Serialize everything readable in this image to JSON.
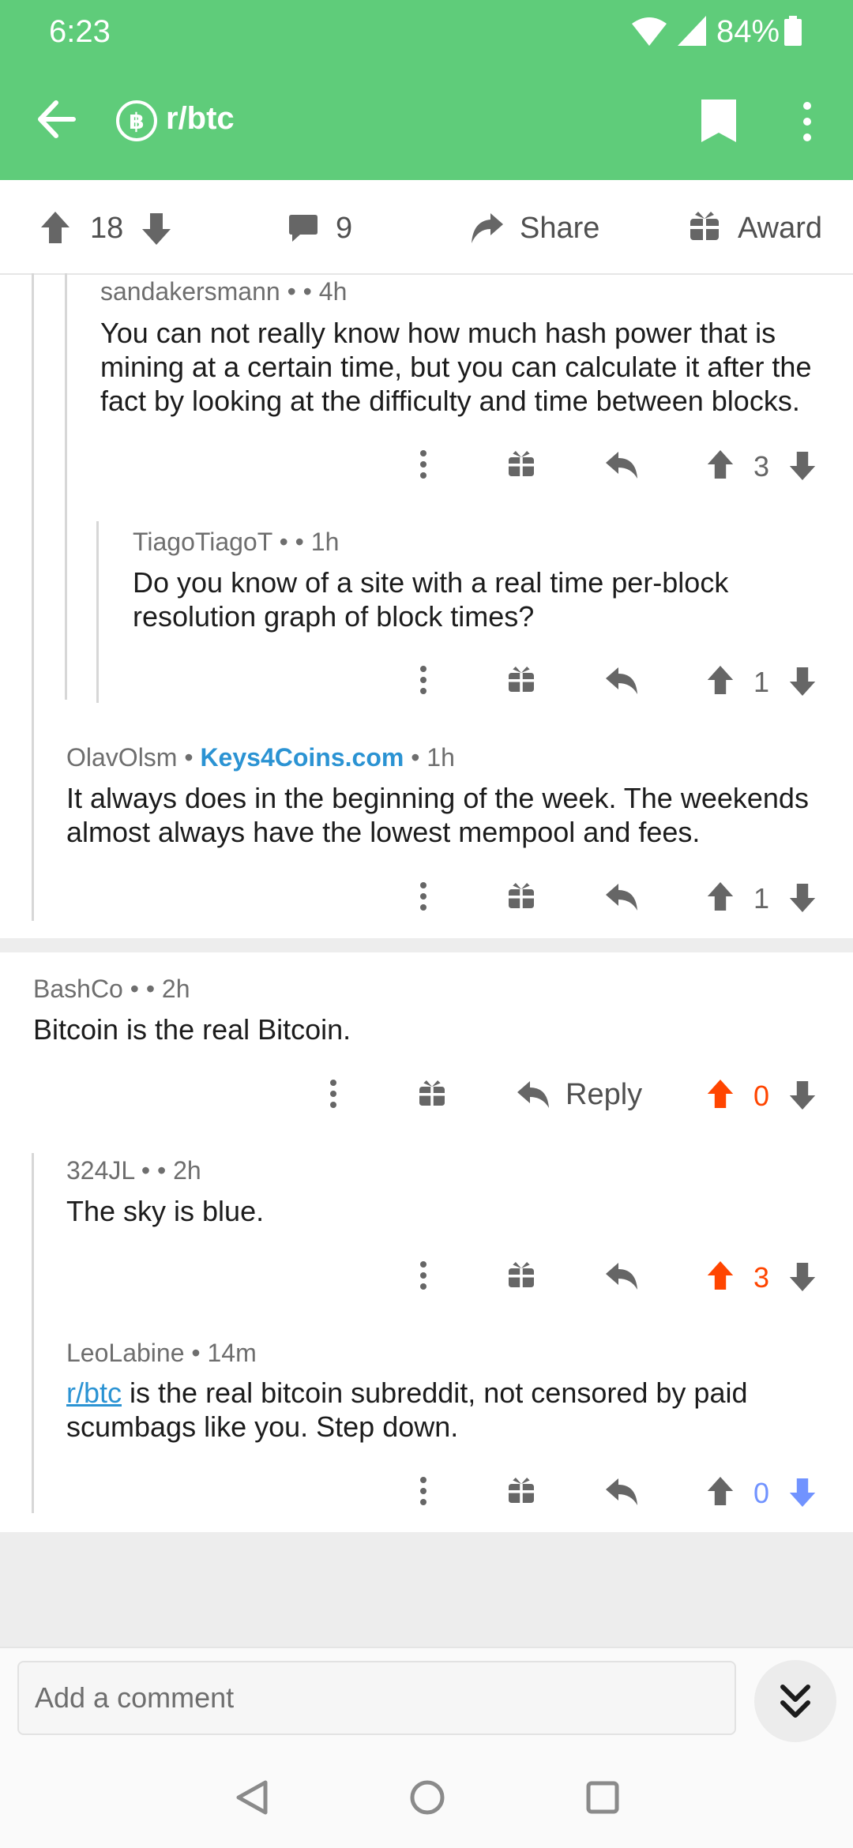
{
  "status_bar": {
    "time": "6:23",
    "battery": "84%"
  },
  "header": {
    "subreddit": "r/btc",
    "colors": {
      "bar": "#5fcc7a"
    }
  },
  "action_bar": {
    "upvotes": "18",
    "comments": "9",
    "share_label": "Share",
    "award_label": "Award"
  },
  "comments": [
    {
      "author": "sandakersmann",
      "sep": "•",
      "time": "• 4h",
      "body": "You can not really know how much hash power that is mining at a certain time, but you can calculate it after the fact by looking at the difficulty and time between blocks.",
      "score": "3"
    },
    {
      "author": "TiagoTiagoT",
      "sep": "•",
      "time": "• 1h",
      "body": "Do you know of a site with a real time per-block resolution graph of block times?",
      "score": "1"
    },
    {
      "author": "OlavOlsm",
      "sep": "•",
      "flair": "Keys4Coins.com",
      "time": "• 1h",
      "body": "It always does in the beginning of the week. The weekends almost always have the lowest mempool and fees.",
      "score": "1"
    },
    {
      "author": "BashCo",
      "sep": "•",
      "time": "• 2h",
      "body": "Bitcoin is the real Bitcoin.",
      "reply_label": "Reply",
      "score": "0"
    },
    {
      "author": "324JL",
      "sep": "•",
      "time": "• 2h",
      "body": "The sky is blue.",
      "score": "3"
    },
    {
      "author": "LeoLabine",
      "time": "• 14m",
      "body_link": "r/btc",
      "body_rest": " is the real bitcoin subreddit, not censored by paid scumbags like you. Step down.",
      "score": "0"
    }
  ],
  "comment_bar": {
    "placeholder": "Add a comment"
  },
  "colors": {
    "upvoted": "#ff4500",
    "downvoted": "#7193ff",
    "link": "#2b93d3"
  }
}
